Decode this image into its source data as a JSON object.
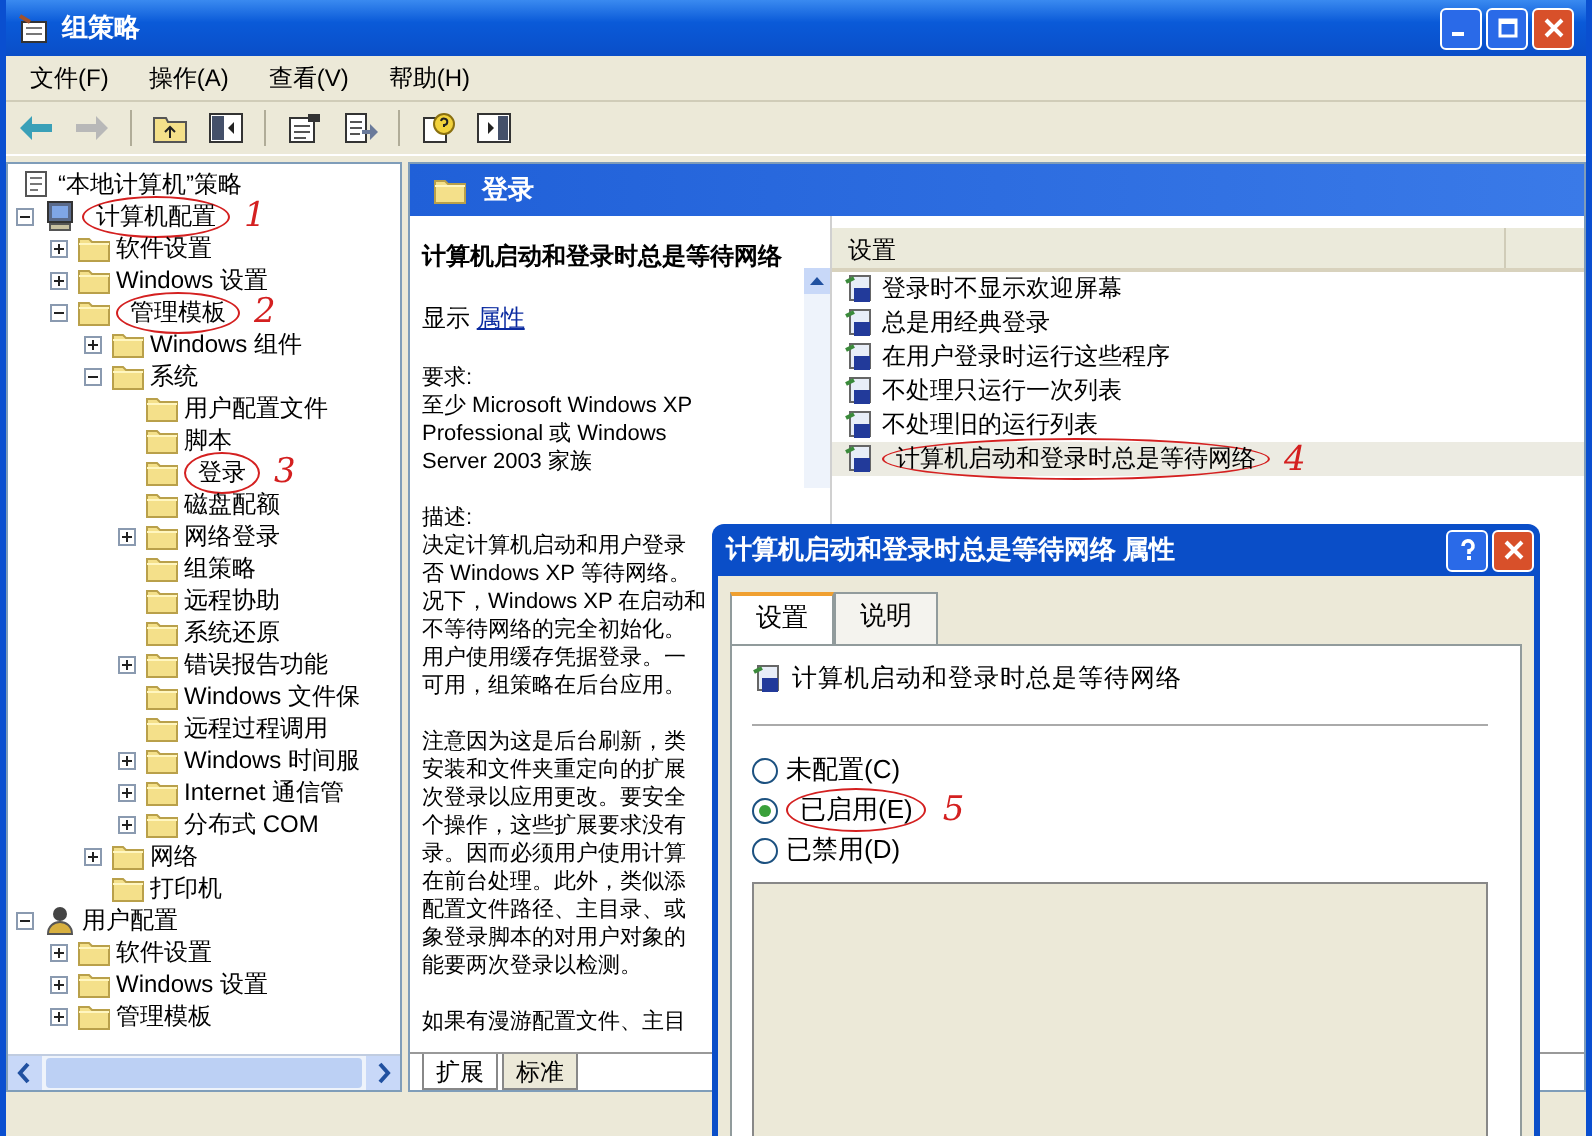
{
  "window": {
    "title": "组策略"
  },
  "menu": [
    "文件(F)",
    "操作(A)",
    "查看(V)",
    "帮助(H)"
  ],
  "toolbar": [
    [
      {
        "kind": "back",
        "disabled": false
      },
      {
        "kind": "forward",
        "disabled": true
      }
    ],
    [
      {
        "kind": "up",
        "disabled": false
      },
      {
        "kind": "tree-toggle",
        "disabled": false
      }
    ],
    [
      {
        "kind": "properties",
        "disabled": false
      },
      {
        "kind": "export",
        "disabled": false
      }
    ],
    [
      {
        "kind": "help",
        "disabled": false
      },
      {
        "kind": "pane",
        "disabled": false
      }
    ]
  ],
  "tree": {
    "label": "“本地计算机”策略",
    "kind": "policy",
    "children": [
      {
        "label": "计算机配置",
        "kind": "computer",
        "expanded": true,
        "annotation": "1",
        "children": [
          {
            "label": "软件设置",
            "kind": "folder",
            "expanded": false
          },
          {
            "label": "Windows 设置",
            "kind": "folder",
            "expanded": false
          },
          {
            "label": "管理模板",
            "kind": "folder",
            "expanded": true,
            "annotation": "2",
            "children": [
              {
                "label": "Windows 组件",
                "kind": "folder",
                "expanded": false
              },
              {
                "label": "系统",
                "kind": "folder",
                "expanded": true,
                "children": [
                  {
                    "label": "用户配置文件",
                    "kind": "folder"
                  },
                  {
                    "label": "脚本",
                    "kind": "folder"
                  },
                  {
                    "label": "登录",
                    "kind": "folder",
                    "annotation": "3"
                  },
                  {
                    "label": "磁盘配额",
                    "kind": "folder"
                  },
                  {
                    "label": "网络登录",
                    "kind": "folder",
                    "expanded": false
                  },
                  {
                    "label": "组策略",
                    "kind": "folder"
                  },
                  {
                    "label": "远程协助",
                    "kind": "folder"
                  },
                  {
                    "label": "系统还原",
                    "kind": "folder"
                  },
                  {
                    "label": "错误报告功能",
                    "kind": "folder",
                    "expanded": false
                  },
                  {
                    "label": "Windows 文件保",
                    "kind": "folder"
                  },
                  {
                    "label": "远程过程调用",
                    "kind": "folder"
                  },
                  {
                    "label": "Windows 时间服",
                    "kind": "folder",
                    "expanded": false
                  },
                  {
                    "label": "Internet 通信管",
                    "kind": "folder",
                    "expanded": false
                  },
                  {
                    "label": "分布式 COM",
                    "kind": "folder",
                    "expanded": false
                  }
                ]
              },
              {
                "label": "网络",
                "kind": "folder",
                "expanded": false
              },
              {
                "label": "打印机",
                "kind": "folder"
              }
            ]
          }
        ]
      },
      {
        "label": "用户配置",
        "kind": "user",
        "expanded": true,
        "children": [
          {
            "label": "软件设置",
            "kind": "folder",
            "expanded": false
          },
          {
            "label": "Windows 设置",
            "kind": "folder",
            "expanded": false
          },
          {
            "label": "管理模板",
            "kind": "folder",
            "expanded": false
          }
        ]
      }
    ]
  },
  "header": {
    "title": "登录"
  },
  "description": {
    "title": "计算机启动和登录时总是等待网络",
    "show_label": "显示",
    "link": "属性",
    "sections": [
      [
        "要求:",
        "至少 Microsoft Windows XP",
        "Professional 或 Windows",
        "Server 2003 家族"
      ],
      [
        "描述:",
        "决定计算机启动和用户登录",
        "否 Windows XP 等待网络。",
        "况下，Windows XP 在启动和",
        "不等待网络的完全初始化。",
        "用户使用缓存凭据登录。一",
        "可用，组策略在后台应用。"
      ],
      [
        "注意因为这是后台刷新，类",
        "安装和文件夹重定向的扩展",
        "次登录以应用更改。要安全",
        "个操作，这些扩展要求没有",
        "录。因而必须用户使用计算",
        "在前台处理。此外，类似添",
        "配置文件路径、主目录、或",
        "象登录脚本的对用户对象的",
        "能要两次登录以检测。"
      ],
      [
        "如果有漫游配置文件、主目"
      ]
    ]
  },
  "list": {
    "columns": [
      "设置"
    ],
    "rows": [
      {
        "label": "登录时不显示欢迎屏幕",
        "selected": false
      },
      {
        "label": "总是用经典登录",
        "selected": false
      },
      {
        "label": "在用户登录时运行这些程序",
        "selected": false
      },
      {
        "label": "不处理只运行一次列表",
        "selected": false
      },
      {
        "label": "不处理旧的运行列表",
        "selected": false
      },
      {
        "label": "计算机启动和登录时总是等待网络",
        "selected": true,
        "annotation": "4"
      }
    ]
  },
  "bottom_tabs": [
    {
      "label": "扩展",
      "selected": true
    },
    {
      "label": "标准",
      "selected": false
    }
  ],
  "dialog": {
    "title": "计算机启动和登录时总是等待网络 属性",
    "tabs": [
      {
        "label": "设置",
        "selected": true
      },
      {
        "label": "说明",
        "selected": false
      }
    ],
    "policy_name": "计算机启动和登录时总是等待网络",
    "options": [
      {
        "label": "未配置(C)",
        "selected": false
      },
      {
        "label": "已启用(E)",
        "selected": true,
        "annotation": "5"
      },
      {
        "label": "已禁用(D)",
        "selected": false
      }
    ]
  }
}
